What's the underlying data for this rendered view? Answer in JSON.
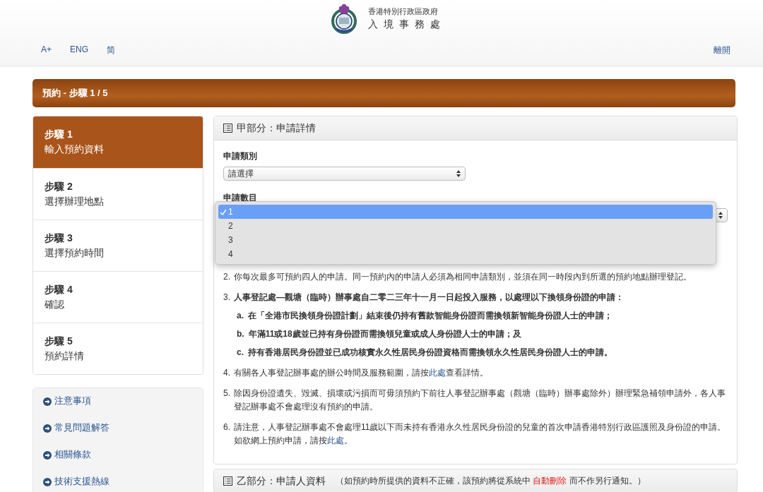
{
  "header": {
    "agency_line1": "香港特別行政區政府",
    "agency_line2": "入 境 事 務 處",
    "toolbar": [
      "A+",
      "ENG",
      "简"
    ],
    "logout": "離開"
  },
  "banner": {
    "title": "預約 - 步驟 1 / 5"
  },
  "steps": [
    {
      "label": "步驟 1",
      "title": "輸入預約資料",
      "selected": true
    },
    {
      "label": "步驟 2",
      "title": "選擇辦理地點",
      "selected": false
    },
    {
      "label": "步驟 3",
      "title": "選擇預約時間",
      "selected": false
    },
    {
      "label": "步驟 4",
      "title": "確認",
      "selected": false
    },
    {
      "label": "步驟 5",
      "title": "預約詳情",
      "selected": false
    }
  ],
  "links": [
    "注意事項",
    "常見問題解答",
    "相關條款",
    "技術支援熱線"
  ],
  "section_a": {
    "title": "甲部分：申請詳情",
    "fields": [
      {
        "label": "申請類別",
        "value": "請選擇"
      },
      {
        "label": "申請數目"
      }
    ],
    "dropdown_options": [
      {
        "label": "1",
        "selected": true
      },
      {
        "label": "2",
        "selected": false
      },
      {
        "label": "3",
        "selected": false
      },
      {
        "label": "4",
        "selected": false
      }
    ],
    "notes": [
      {
        "number": "2.",
        "bold": false,
        "parts": [
          {
            "kind": "text",
            "text": "你每次最多可預約四人的申請。同一預約內的申請人必須為相同申請類別，並須在同一時段內到所選的預約地點辦理登記。"
          }
        ]
      },
      {
        "number": "3.",
        "bold": true,
        "parts": [
          {
            "kind": "text",
            "text": "人事登記處—觀塘（臨時）辦事處自二零二三年十一月一日起投入服務，以處理以下換領身份證的申請："
          }
        ],
        "sub": [
          {
            "letter": "a.",
            "text": "在「全港市民換領身份證計劃」結束後仍持有舊款智能身份證而需換領新智能身份證人士的申請；"
          },
          {
            "letter": "b.",
            "text": "年滿11或18歲並已持有身份證而需換領兒童或成人身份證人士的申請；及"
          },
          {
            "letter": "c.",
            "text": "持有香港居民身份證並已成功核實永久性居民身份證資格而需換領永久性居民身份證人士的申請。"
          }
        ]
      },
      {
        "number": "4.",
        "bold": false,
        "parts": [
          {
            "kind": "text",
            "text": "有關各人事登記辦事處的辦公時間及服務範圍，請按"
          },
          {
            "kind": "link",
            "text": "此處"
          },
          {
            "kind": "text",
            "text": "查看詳情。"
          }
        ]
      },
      {
        "number": "5.",
        "bold": false,
        "parts": [
          {
            "kind": "text",
            "text": "除因身份證遺失、毀滅、損壞或污損而可毋須預約下前往人事登記辦事處（觀塘（臨時）辦事處除外）辦理緊急補領申請外，各人事登記辦事處不會處理沒有預約的申請。"
          }
        ]
      },
      {
        "number": "6.",
        "bold": false,
        "parts": [
          {
            "kind": "text",
            "text": "請注意，人事登記辦事處不會處理11歲以下而未持有香港永久性居民身份證的兒童的首次申請香港特別行政區護照及身份證的申請。如欲網上預約申請，請按"
          },
          {
            "kind": "link",
            "text": "此處"
          },
          {
            "kind": "text",
            "text": "。"
          }
        ]
      }
    ]
  },
  "section_b": {
    "title": "乙部分：申請人資料",
    "note": [
      {
        "kind": "text",
        "text": "（如預約時所提供的資料不正確，該預約將從系統中 "
      },
      {
        "kind": "alert",
        "text": "自動刪除"
      },
      {
        "kind": "text",
        "text": " 而不作另行通知。）"
      }
    ]
  }
}
